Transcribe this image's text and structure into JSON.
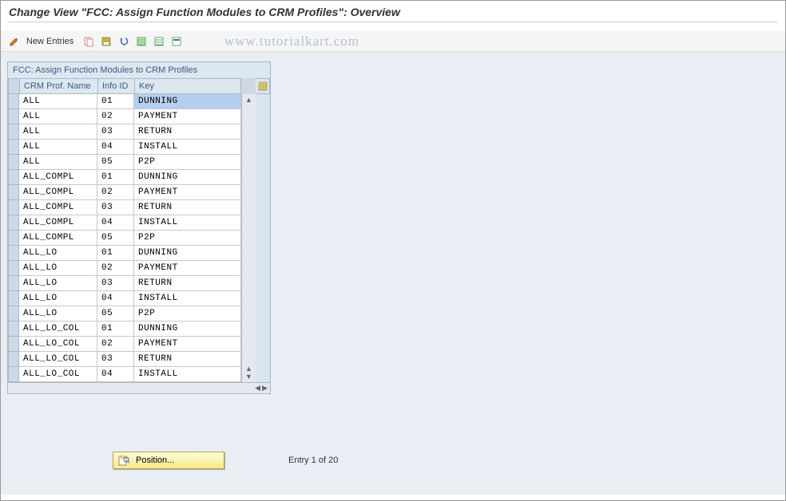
{
  "title": "Change View \"FCC: Assign Function Modules to CRM Profiles\": Overview",
  "watermark": "www.tutorialkart.com",
  "toolbar": {
    "new_entries": "New Entries"
  },
  "panel": {
    "title": "FCC: Assign Function Modules to CRM Profiles",
    "columns": {
      "c1": "CRM Prof. Name",
      "c2": "Info ID",
      "c3": "Key"
    }
  },
  "rows": [
    {
      "name": "ALL",
      "info": "01",
      "key": "DUNNING",
      "selected": true
    },
    {
      "name": "ALL",
      "info": "02",
      "key": "PAYMENT"
    },
    {
      "name": "ALL",
      "info": "03",
      "key": "RETURN"
    },
    {
      "name": "ALL",
      "info": "04",
      "key": "INSTALL"
    },
    {
      "name": "ALL",
      "info": "05",
      "key": "P2P"
    },
    {
      "name": "ALL_COMPL",
      "info": "01",
      "key": "DUNNING"
    },
    {
      "name": "ALL_COMPL",
      "info": "02",
      "key": "PAYMENT"
    },
    {
      "name": "ALL_COMPL",
      "info": "03",
      "key": "RETURN"
    },
    {
      "name": "ALL_COMPL",
      "info": "04",
      "key": "INSTALL"
    },
    {
      "name": "ALL_COMPL",
      "info": "05",
      "key": "P2P"
    },
    {
      "name": "ALL_LO",
      "info": "01",
      "key": "DUNNING"
    },
    {
      "name": "ALL_LO",
      "info": "02",
      "key": "PAYMENT"
    },
    {
      "name": "ALL_LO",
      "info": "03",
      "key": "RETURN"
    },
    {
      "name": "ALL_LO",
      "info": "04",
      "key": "INSTALL"
    },
    {
      "name": "ALL_LO",
      "info": "05",
      "key": "P2P"
    },
    {
      "name": "ALL_LO_COL",
      "info": "01",
      "key": "DUNNING"
    },
    {
      "name": "ALL_LO_COL",
      "info": "02",
      "key": "PAYMENT"
    },
    {
      "name": "ALL_LO_COL",
      "info": "03",
      "key": "RETURN"
    },
    {
      "name": "ALL_LO_COL",
      "info": "04",
      "key": "INSTALL"
    }
  ],
  "footer": {
    "position_label": "Position...",
    "entry_text": "Entry 1 of 20"
  }
}
